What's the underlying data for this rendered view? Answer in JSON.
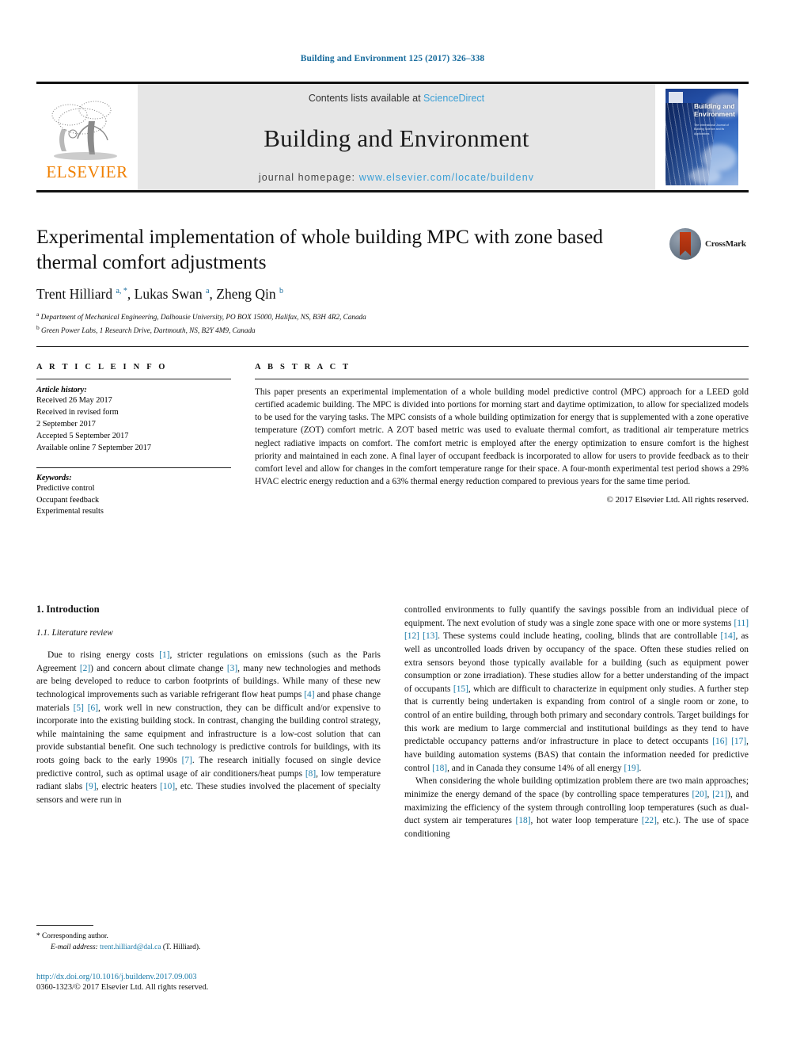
{
  "running_head": "Building and Environment 125 (2017) 326–338",
  "masthead": {
    "contents_prefix": "Contents lists available at ",
    "sciencedirect": "ScienceDirect",
    "journal_title": "Building and Environment",
    "homepage_prefix": "journal homepage: ",
    "homepage_url": "www.elsevier.com/locate/buildenv",
    "publisher": "ELSEVIER",
    "cover_title": "Building and Environment",
    "cover_subtitle": "The International Journal of Building Science and its Applications"
  },
  "article": {
    "title": "Experimental implementation of whole building MPC with zone based thermal comfort adjustments",
    "crossmark_label": "CrossMark",
    "authors_html": "Trent Hilliard <sup>a, *</sup>, Lukas Swan <sup>a</sup>, Zheng Qin <sup>b</sup>",
    "affiliation_a": "Department of Mechanical Engineering, Dalhousie University, PO BOX 15000, Halifax, NS, B3H 4R2, Canada",
    "affiliation_b": "Green Power Labs, 1 Research Drive, Dartmouth, NS, B2Y 4M9, Canada"
  },
  "article_info": {
    "heading": "A R T I C L E   I N F O",
    "history_title": "Article history:",
    "history": [
      "Received 26 May 2017",
      "Received in revised form",
      "2 September 2017",
      "Accepted 5 September 2017",
      "Available online 7 September 2017"
    ],
    "keywords_title": "Keywords:",
    "keywords": [
      "Predictive control",
      "Occupant feedback",
      "Experimental results"
    ]
  },
  "abstract": {
    "heading": "A B S T R A C T",
    "text": "This paper presents an experimental implementation of a whole building model predictive control (MPC) approach for a LEED gold certified academic building. The MPC is divided into portions for morning start and daytime optimization, to allow for specialized models to be used for the varying tasks. The MPC consists of a whole building optimization for energy that is supplemented with a zone operative temperature (ZOT) comfort metric. A ZOT based metric was used to evaluate thermal comfort, as traditional air temperature metrics neglect radiative impacts on comfort. The comfort metric is employed after the energy optimization to ensure comfort is the highest priority and maintained in each zone. A final layer of occupant feedback is incorporated to allow for users to provide feedback as to their comfort level and allow for changes in the comfort temperature range for their space. A four-month experimental test period shows a 29% HVAC electric energy reduction and a 63% thermal energy reduction compared to previous years for the same time period.",
    "copyright": "© 2017 Elsevier Ltd. All rights reserved."
  },
  "body": {
    "section_number_title": "1. Introduction",
    "subsection_number_title": "1.1. Literature review",
    "left_paragraph_html": "Due to rising energy costs <span class=\"ref\">[1]</span>, stricter regulations on emissions (such as the Paris Agreement <span class=\"ref\">[2]</span>) and concern about climate change <span class=\"ref\">[3]</span>, many new technologies and methods are being developed to reduce to carbon footprints of buildings. While many of these new technological improvements such as variable refrigerant flow heat pumps <span class=\"ref\">[4]</span> and phase change materials <span class=\"ref\">[5]</span> <span class=\"ref\">[6]</span>, work well in new construction, they can be difficult and/or expensive to incorporate into the existing building stock. In contrast, changing the building control strategy, while maintaining the same equipment and infrastructure is a low-cost solution that can provide substantial benefit. One such technology is predictive controls for buildings, with its roots going back to the early 1990s <span class=\"ref\">[7]</span>. The research initially focused on single device predictive control, such as optimal usage of air conditioners/heat pumps <span class=\"ref\">[8]</span>, low temperature radiant slabs <span class=\"ref\">[9]</span>, electric heaters <span class=\"ref\">[10]</span>, etc. These studies involved the placement of specialty sensors and were run in",
    "right_paragraph_1_html": "controlled environments to fully quantify the savings possible from an individual piece of equipment. The next evolution of study was a single zone space with one or more systems <span class=\"ref\">[11]</span> <span class=\"ref\">[12]</span> <span class=\"ref\">[13]</span>. These systems could include heating, cooling, blinds that are controllable <span class=\"ref\">[14]</span>, as well as uncontrolled loads driven by occupancy of the space. Often these studies relied on extra sensors beyond those typically available for a building (such as equipment power consumption or zone irradiation). These studies allow for a better understanding of the impact of occupants <span class=\"ref\">[15]</span>, which are difficult to characterize in equipment only studies. A further step that is currently being undertaken is expanding from control of a single room or zone, to control of an entire building, through both primary and secondary controls. Target buildings for this work are medium to large commercial and institutional buildings as they tend to have predictable occupancy patterns and/or infrastructure in place to detect occupants <span class=\"ref\">[16]</span> <span class=\"ref\">[17]</span>, have building automation systems (BAS) that contain the information needed for predictive control <span class=\"ref\">[18]</span>, and in Canada they consume 14% of all energy <span class=\"ref\">[19]</span>.",
    "right_paragraph_2_html": "When considering the whole building optimization problem there are two main approaches; minimize the energy demand of the space (by controlling space temperatures <span class=\"ref\">[20]</span>, <span class=\"ref\">[21]</span>), and maximizing the efficiency of the system through controlling loop temperatures (such as dual-duct system air temperatures <span class=\"ref\">[18]</span>, hot water loop temperature <span class=\"ref\">[22]</span>, etc.). The use of space conditioning"
  },
  "footer": {
    "corresponding_marker": "*",
    "corresponding_author": "Corresponding author.",
    "email_label": "E-mail address:",
    "email": "trent.hilliard@dal.ca",
    "email_suffix": "(T. Hilliard).",
    "doi": "http://dx.doi.org/10.1016/j.buildenv.2017.09.003",
    "issn_line": "0360-1323/© 2017 Elsevier Ltd. All rights reserved."
  },
  "colors": {
    "link": "#1a7aa8",
    "header_link": "#1a6d9e",
    "sciencedirect": "#3a9fd6",
    "elsevier_orange": "#F08000"
  }
}
